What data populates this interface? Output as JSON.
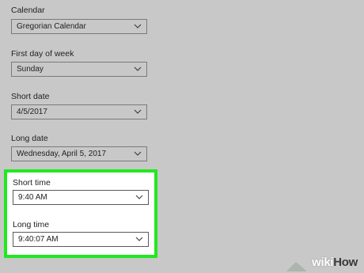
{
  "settings": {
    "calendar": {
      "label": "Calendar",
      "value": "Gregorian Calendar"
    },
    "first_day": {
      "label": "First day of week",
      "value": "Sunday"
    },
    "short_date": {
      "label": "Short date",
      "value": "4/5/2017"
    },
    "long_date": {
      "label": "Long date",
      "value": "Wednesday, April 5, 2017"
    },
    "short_time": {
      "label": "Short time",
      "value": "9:40 AM"
    },
    "long_time": {
      "label": "Long time",
      "value": "9:40:07 AM"
    }
  },
  "highlight_color": "#22e81f",
  "chevron_icon": "chevron-down-icon",
  "watermark": {
    "wiki": "wiki",
    "how": "How"
  }
}
